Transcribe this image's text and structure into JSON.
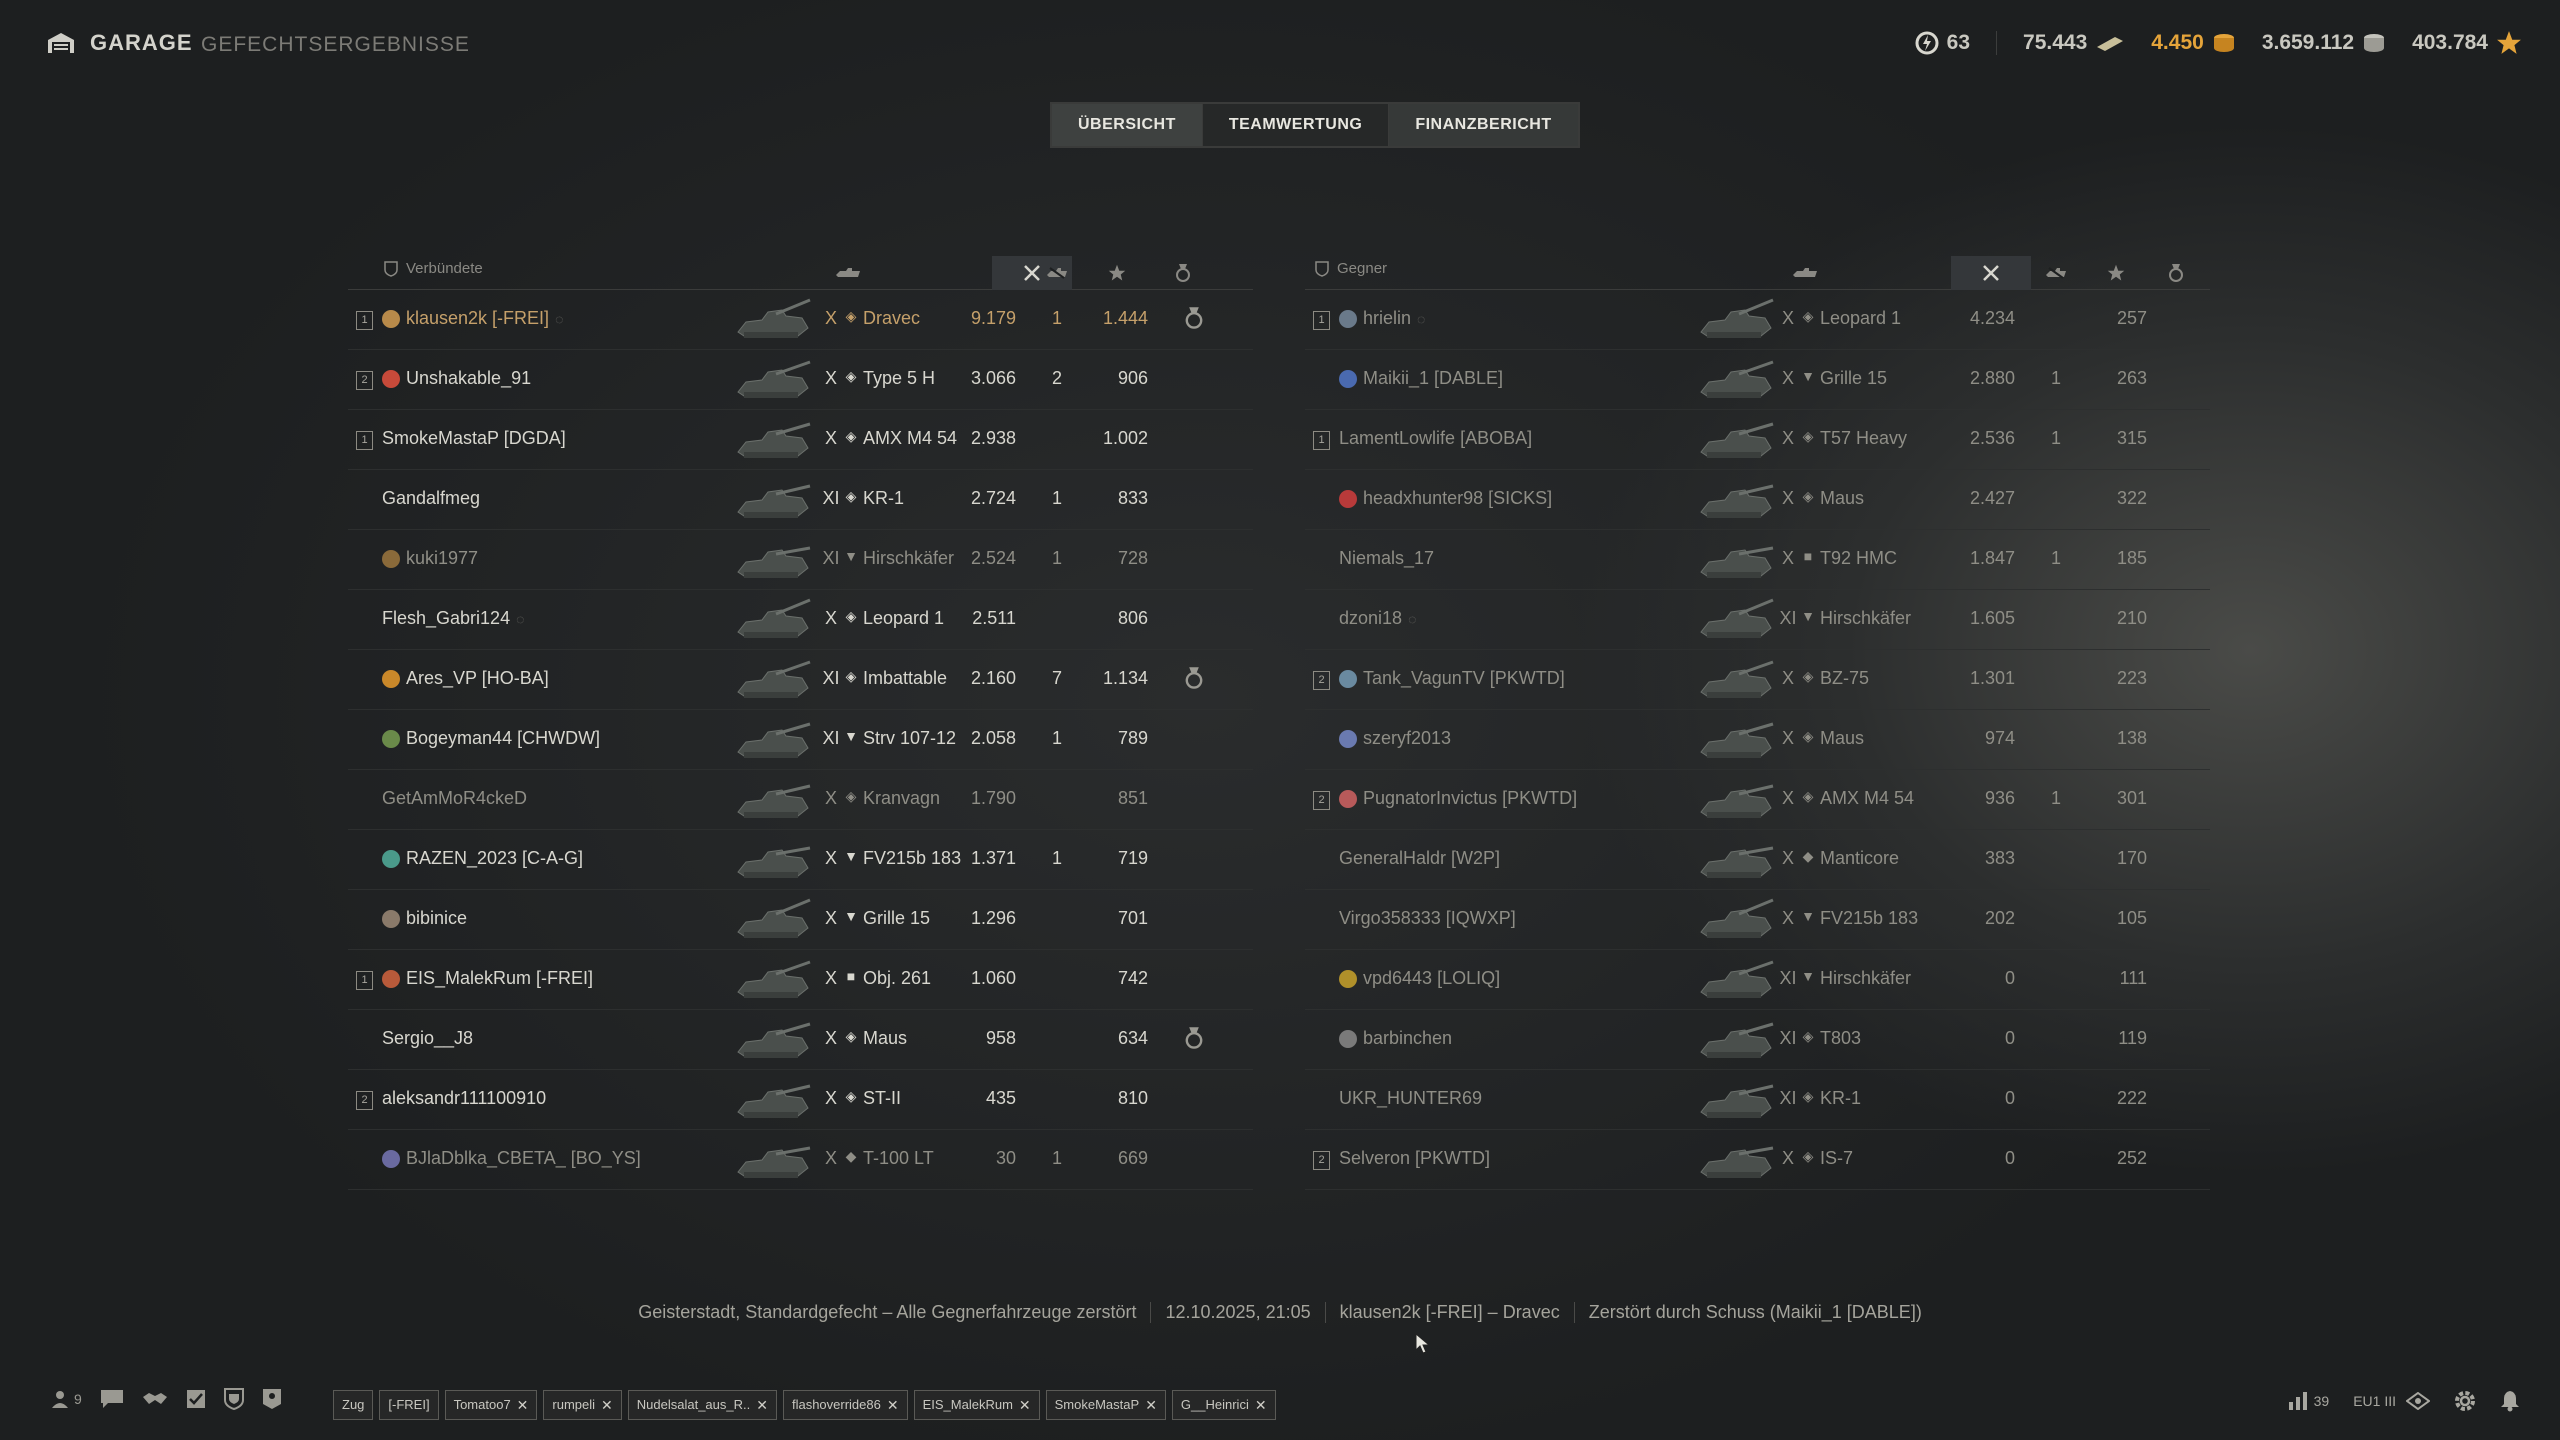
{
  "header": {
    "garage_label": "GARAGE",
    "results_title": "GEFECHTSERGEBNISSE",
    "free_xp": "63",
    "credits_bonds": "75.443",
    "gold": "4.450",
    "credits": "3.659.112",
    "xp": "403.784"
  },
  "tabs": [
    "ÜBERSICHT",
    "TEAMWERTUNG",
    "FINANZBERICHT"
  ],
  "allies": {
    "label": "Verbündete",
    "rows": [
      {
        "platoon": "1",
        "name": "klausen2k [-FREI]",
        "tier": "X",
        "vehicle": "Dravec",
        "damage": "9.179",
        "kills": "1",
        "xp": "1.444",
        "medal": true,
        "style": "me",
        "clan_color": "#b88a4a",
        "hidden_icon": true,
        "cls": "◈"
      },
      {
        "platoon": "2",
        "name": "Unshakable_91",
        "tier": "X",
        "vehicle": "Type 5 H",
        "damage": "3.066",
        "kills": "2",
        "xp": "906",
        "medal": false,
        "style": "",
        "clan_color": "#c74a3a",
        "cls": "◈"
      },
      {
        "platoon": "1",
        "name": "SmokeMastaP [DGDA]",
        "tier": "X",
        "vehicle": "AMX M4 54",
        "damage": "2.938",
        "kills": "",
        "xp": "1.002",
        "medal": false,
        "style": "",
        "cls": "◈"
      },
      {
        "platoon": "",
        "name": "Gandalfmeg",
        "tier": "XI",
        "vehicle": "KR-1",
        "damage": "2.724",
        "kills": "1",
        "xp": "833",
        "medal": false,
        "style": "",
        "cls": "◈"
      },
      {
        "platoon": "",
        "name": "kuki1977",
        "tier": "XI",
        "vehicle": "Hirschkäfer",
        "damage": "2.524",
        "kills": "1",
        "xp": "728",
        "medal": false,
        "style": "dim",
        "clan_color": "#8a6a3a",
        "cls": "▼"
      },
      {
        "platoon": "",
        "name": "Flesh_Gabri124",
        "tier": "X",
        "vehicle": "Leopard 1",
        "damage": "2.511",
        "kills": "",
        "xp": "806",
        "medal": false,
        "style": "",
        "hidden_icon": true,
        "cls": "◈"
      },
      {
        "platoon": "",
        "name": "Ares_VP [HO-BA]",
        "tier": "XI",
        "vehicle": "Imbattable",
        "damage": "2.160",
        "kills": "7",
        "xp": "1.134",
        "medal": true,
        "style": "",
        "clan_color": "#c9882a",
        "cls": "◈"
      },
      {
        "platoon": "",
        "name": "Bogeyman44 [CHWDW]",
        "tier": "XI",
        "vehicle": "Strv 107-12",
        "damage": "2.058",
        "kills": "1",
        "xp": "789",
        "medal": false,
        "style": "",
        "clan_color": "#6a8a4a",
        "cls": "▼"
      },
      {
        "platoon": "",
        "name": "GetAmMoR4ckeD",
        "tier": "X",
        "vehicle": "Kranvagn",
        "damage": "1.790",
        "kills": "",
        "xp": "851",
        "medal": false,
        "style": "dim",
        "cls": "◈"
      },
      {
        "platoon": "",
        "name": "RAZEN_2023 [C-A-G]",
        "tier": "X",
        "vehicle": "FV215b 183",
        "damage": "1.371",
        "kills": "1",
        "xp": "719",
        "medal": false,
        "style": "",
        "clan_color": "#4a9a8a",
        "cls": "▼"
      },
      {
        "platoon": "",
        "name": "bibinice",
        "tier": "X",
        "vehicle": "Grille 15",
        "damage": "1.296",
        "kills": "",
        "xp": "701",
        "medal": false,
        "style": "",
        "clan_color": "#8a7a6a",
        "cls": "▼"
      },
      {
        "platoon": "1",
        "name": "EIS_MalekRum [-FREI]",
        "tier": "X",
        "vehicle": "Obj. 261",
        "damage": "1.060",
        "kills": "",
        "xp": "742",
        "medal": false,
        "style": "",
        "clan_color": "#b85a3a",
        "cls": "■"
      },
      {
        "platoon": "",
        "name": "Sergio__J8",
        "tier": "X",
        "vehicle": "Maus",
        "damage": "958",
        "kills": "",
        "xp": "634",
        "medal": true,
        "style": "",
        "cls": "◈"
      },
      {
        "platoon": "2",
        "name": "aleksandr111100910",
        "tier": "X",
        "vehicle": "ST-II",
        "damage": "435",
        "kills": "",
        "xp": "810",
        "medal": false,
        "style": "",
        "cls": "◈"
      },
      {
        "platoon": "",
        "name": "BJlaDblka_CBETA_ [BO_YS]",
        "tier": "X",
        "vehicle": "T-100 LT",
        "damage": "30",
        "kills": "1",
        "xp": "669",
        "medal": false,
        "style": "dim",
        "clan_color": "#6a6aa0",
        "cls": "◆"
      }
    ]
  },
  "enemies": {
    "label": "Gegner",
    "rows": [
      {
        "platoon": "1",
        "name": "hrielin",
        "tier": "X",
        "vehicle": "Leopard 1",
        "damage": "4.234",
        "kills": "",
        "xp": "257",
        "style": "dim",
        "clan_color": "#6a7a8a",
        "hidden_icon": true,
        "cls": "◈"
      },
      {
        "platoon": "",
        "name": "Maikii_1 [DABLE]",
        "tier": "X",
        "vehicle": "Grille 15",
        "damage": "2.880",
        "kills": "1",
        "xp": "263",
        "style": "dim",
        "clan_color": "#4a6ab0",
        "cls": "▼"
      },
      {
        "platoon": "1",
        "name": "LamentLowlife [ABOBA]",
        "tier": "X",
        "vehicle": "T57 Heavy",
        "damage": "2.536",
        "kills": "1",
        "xp": "315",
        "style": "dim",
        "cls": "◈"
      },
      {
        "platoon": "",
        "name": "headxhunter98 [SICKS]",
        "tier": "X",
        "vehicle": "Maus",
        "damage": "2.427",
        "kills": "",
        "xp": "322",
        "style": "dim",
        "clan_color": "#b83a3a",
        "cls": "◈"
      },
      {
        "platoon": "",
        "name": "Niemals_17",
        "tier": "X",
        "vehicle": "T92 HMC",
        "damage": "1.847",
        "kills": "1",
        "xp": "185",
        "style": "dim",
        "cls": "■"
      },
      {
        "platoon": "",
        "name": "dzoni18",
        "tier": "XI",
        "vehicle": "Hirschkäfer",
        "damage": "1.605",
        "kills": "",
        "xp": "210",
        "style": "dim",
        "hidden_icon": true,
        "cls": "▼"
      },
      {
        "platoon": "2",
        "name": "Tank_VagunTV [PKWTD]",
        "tier": "X",
        "vehicle": "BZ-75",
        "damage": "1.301",
        "kills": "",
        "xp": "223",
        "style": "dim",
        "clan_color": "#6a8aa0",
        "cls": "◈"
      },
      {
        "platoon": "",
        "name": "szeryf2013",
        "tier": "X",
        "vehicle": "Maus",
        "damage": "974",
        "kills": "",
        "xp": "138",
        "style": "dim",
        "clan_color": "#6a7ab0",
        "cls": "◈"
      },
      {
        "platoon": "2",
        "name": "PugnatorInvictus [PKWTD]",
        "tier": "X",
        "vehicle": "AMX M4 54",
        "damage": "936",
        "kills": "1",
        "xp": "301",
        "style": "dim",
        "clan_color": "#b85a5a",
        "cls": "◈"
      },
      {
        "platoon": "",
        "name": "GeneralHaldr [W2P]",
        "tier": "X",
        "vehicle": "Manticore",
        "damage": "383",
        "kills": "",
        "xp": "170",
        "style": "dim",
        "cls": "◆"
      },
      {
        "platoon": "",
        "name": "Virgo358333 [IQWXP]",
        "tier": "X",
        "vehicle": "FV215b 183",
        "damage": "202",
        "kills": "",
        "xp": "105",
        "style": "dim",
        "cls": "▼"
      },
      {
        "platoon": "",
        "name": "vpd6443 [LOLIQ]",
        "tier": "XI",
        "vehicle": "Hirschkäfer",
        "damage": "0",
        "kills": "",
        "xp": "111",
        "style": "dim",
        "clan_color": "#b0902a",
        "cls": "▼"
      },
      {
        "platoon": "",
        "name": "barbinchen",
        "tier": "XI",
        "vehicle": "T803",
        "damage": "0",
        "kills": "",
        "xp": "119",
        "style": "dim",
        "clan_color": "#7a7a7a",
        "cls": "◈"
      },
      {
        "platoon": "",
        "name": "UKR_HUNTER69",
        "tier": "XI",
        "vehicle": "KR-1",
        "damage": "0",
        "kills": "",
        "xp": "222",
        "style": "dim",
        "cls": "◈"
      },
      {
        "platoon": "2",
        "name": "Selveron [PKWTD]",
        "tier": "X",
        "vehicle": "IS-7",
        "damage": "0",
        "kills": "",
        "xp": "252",
        "style": "dim",
        "cls": "◈"
      }
    ]
  },
  "battle_info": [
    "Geisterstadt, Standardgefecht – Alle Gegnerfahrzeuge zerstört",
    "12.10.2025, 21:05",
    "klausen2k [-FREI] – Dravec",
    "Zerstört durch Schuss (Maikii_1 [DABLE])"
  ],
  "bottom": {
    "friends_count": "9",
    "chips": [
      "Zug",
      "[-FREI]",
      "Tomatoo7",
      "rumpeli",
      "Nudelsalat_aus_R..",
      "flashoverride86",
      "EIS_MalekRum",
      "SmokeMastaP",
      "G__Heinrici"
    ],
    "chips_closable": [
      false,
      false,
      true,
      true,
      true,
      true,
      true,
      true,
      true
    ],
    "ping": "39",
    "server": "EU1 III"
  }
}
